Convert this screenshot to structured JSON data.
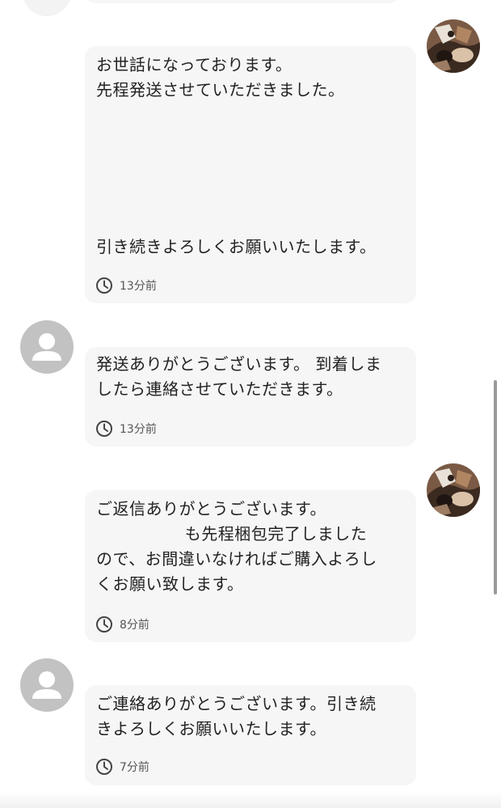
{
  "messages": [
    {
      "sender": "other",
      "lines": [
        "お世話になっております。",
        "先程発送させていただきました。",
        "",
        "",
        "",
        "",
        "引き続きよろしくお願いいたします。"
      ],
      "time": "13分前"
    },
    {
      "sender": "self",
      "lines": [
        "発送ありがとうございます。 到着しま",
        "したら連絡させていただきます。"
      ],
      "time": "13分前"
    },
    {
      "sender": "other",
      "lines": [
        "ご返信ありがとうございます。",
        "                も先程梱包完了しました",
        "ので、お間違いなければご購入よろし",
        "くお願い致します。"
      ],
      "time": "8分前"
    },
    {
      "sender": "self",
      "lines": [
        "ご連絡ありがとうございます。引き続",
        "きよろしくお願いいたします。"
      ],
      "time": "7分前"
    }
  ],
  "icons": {
    "clock": "clock-icon",
    "default_avatar": "default-user-icon",
    "photo_avatar": "cat-photo-avatar"
  },
  "colors": {
    "bubble": "#f6f6f6",
    "default_avatar": "#c2c2c2",
    "text": "#222222",
    "time": "#555555"
  }
}
